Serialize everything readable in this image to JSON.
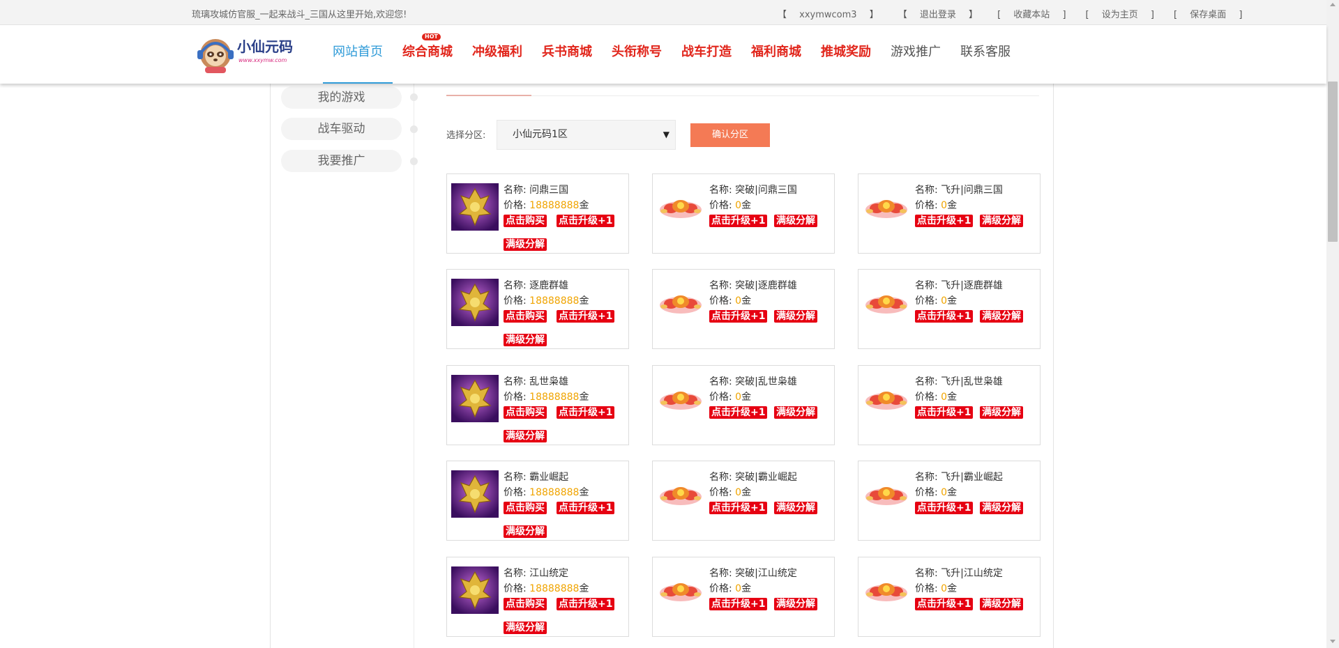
{
  "topbar": {
    "welcome": "琉璃攻城仿官服_一起来战斗_三国从这里开始,欢迎您!",
    "links": [
      {
        "label": "xxymwcom3",
        "open": "【",
        "close": "】"
      },
      {
        "label": "退出登录",
        "open": "【",
        "close": "】"
      },
      {
        "label": "收藏本站",
        "open": "[",
        "close": "]"
      },
      {
        "label": "设为主页",
        "open": "[",
        "close": "]"
      },
      {
        "label": "保存桌面",
        "open": "[",
        "close": "]"
      }
    ]
  },
  "logo": {
    "text": "小仙元码",
    "url_text": "www.xxymw.com"
  },
  "nav": {
    "hot_badge": "HOT",
    "items": [
      {
        "label": "网站首页"
      },
      {
        "label": "综合商城"
      },
      {
        "label": "冲级福利"
      },
      {
        "label": "兵书商城"
      },
      {
        "label": "头衔称号"
      },
      {
        "label": "战车打造"
      },
      {
        "label": "福利商城"
      },
      {
        "label": "推城奖励"
      },
      {
        "label": "游戏推广"
      },
      {
        "label": "联系客服"
      }
    ]
  },
  "sidebar": {
    "items": [
      {
        "label": "我的游戏"
      },
      {
        "label": "战车驱动"
      },
      {
        "label": "我要推广"
      }
    ]
  },
  "zone": {
    "label": "选择分区:",
    "selected": "小仙元码1区",
    "confirm": "确认分区"
  },
  "labels": {
    "name": "名称:",
    "price": "价格:",
    "unit": "金",
    "buy": "点击购买",
    "upgrade": "点击升级+1",
    "decompose": "满级分解"
  },
  "rows": [
    {
      "base": "问鼎三国",
      "breakthrough": "突破|问鼎三国",
      "ascend": "飞升|问鼎三国",
      "price": "18888888",
      "zero": "0"
    },
    {
      "base": "逐鹿群雄",
      "breakthrough": "突破|逐鹿群雄",
      "ascend": "飞升|逐鹿群雄",
      "price": "18888888",
      "zero": "0"
    },
    {
      "base": "乱世枭雄",
      "breakthrough": "突破|乱世枭雄",
      "ascend": "飞升|乱世枭雄",
      "price": "18888888",
      "zero": "0"
    },
    {
      "base": "霸业崛起",
      "breakthrough": "突破|霸业崛起",
      "ascend": "飞升|霸业崛起",
      "price": "18888888",
      "zero": "0"
    },
    {
      "base": "江山统定",
      "breakthrough": "突破|江山统定",
      "ascend": "飞升|江山统定",
      "price": "18888888",
      "zero": "0"
    }
  ],
  "colors": {
    "accent": "#2f9bd8",
    "red": "#e1251b",
    "button_red": "#e60012",
    "price": "#f0a400",
    "confirm": "#f47a55"
  }
}
